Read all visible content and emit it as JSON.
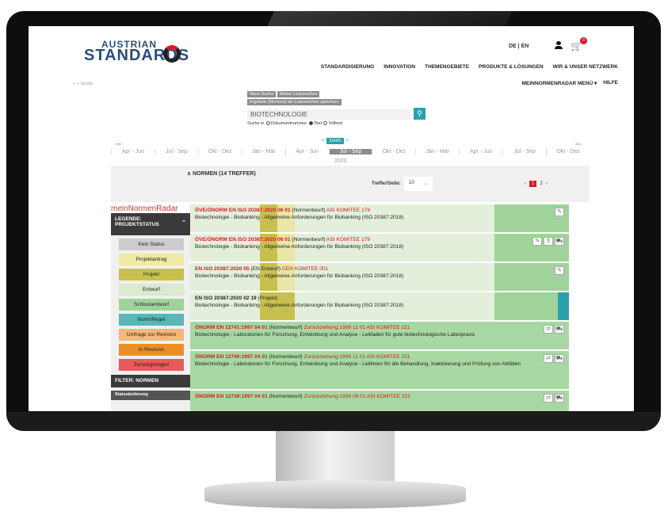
{
  "header": {
    "logo_small": "AUSTRIAN",
    "logo_big": "STANDARDS",
    "lang": "DE | EN",
    "cart_count": "0",
    "nav": [
      "STANDARDISIERUNG",
      "INNOVATION",
      "THEMENGEBIETE",
      "PRODUKTE & LÖSUNGEN",
      "WIR & UNSER NETZWERK"
    ],
    "breadcrumb": "⌂ > Suche",
    "subnav": [
      "MEINNORMENRADAR MENÜ ▾",
      "HILFE"
    ]
  },
  "search": {
    "btn_new": "Neue Suche",
    "btn_mark": "Meine Lesezeichen",
    "btn_save": "Ergebnis (Normen) als Lesezeichen speichern",
    "query": "BIOTECHNOLOGIE",
    "search_in_label": "Suche in",
    "opt_docnr": "Dokumentnummer",
    "opt_title": "Titel",
    "opt_fulltext": "Volltext"
  },
  "timeline": {
    "prev": "<<",
    "next": ">>",
    "zoom_label": "zoom",
    "periods": [
      "Apr - Jun",
      "Jul - Sep",
      "Okt - Dez",
      "Jän - Mär",
      "Apr - Jun",
      "Jul - Sep",
      "Okt - Dez",
      "Jän - Mär",
      "Apr - Jun",
      "Jul - Sep",
      "Okt - Dez"
    ],
    "selected_index": 5,
    "year": "2020"
  },
  "results": {
    "title": "∧  NORMEN (14 TREFFER)",
    "per_page_label": "Treffer/Seite:",
    "per_page": "10",
    "pages": [
      "‹",
      "1",
      "2",
      "›"
    ]
  },
  "sidebar": {
    "radar_title": "meinNormenRadar",
    "legend_title": "LEGENDE: PROJEKTSTATUS",
    "legend": [
      {
        "label": "Kein Status",
        "color": "#cccccc"
      },
      {
        "label": "Projektantrag",
        "color": "#efeaa4"
      },
      {
        "label": "Projekt",
        "color": "#c7c04f"
      },
      {
        "label": "Entwurf",
        "color": "#dbe9cf"
      },
      {
        "label": "Schlussentwurf",
        "color": "#9fd39a"
      },
      {
        "label": "Norm/Regel",
        "color": "#5bb6b8"
      },
      {
        "label": "Umfrage zur Revision",
        "color": "#f0b977"
      },
      {
        "label": "In Revision",
        "color": "#ec8e26"
      },
      {
        "label": "Zurückgezogen",
        "color": "#e85a57"
      }
    ],
    "filter_title": "FILTER: NORMEN",
    "status_change": "Statusänderung"
  },
  "rows": [
    {
      "id": "ÖVE/ÖNORM EN ISO 20387:2020 06 01",
      "type": " (Normentwurf) ",
      "extra": "ASI KOMITEE 179",
      "desc": "Biotechnologie - Biobanking - Allgemeine Anforderungen für Biobanking (ISO 20387:2018)",
      "bg": "#e3efdb",
      "id_red": true
    },
    {
      "id": "ÖVE/ÖNORM EN ISO 20387:2020 06 01",
      "type": " (Normentwurf) ",
      "extra": "ASI KOMITEE 179",
      "desc": "Biotechnologie - Biobanking - Allgemeine Anforderungen für Biobanking (ISO 20387:2018)",
      "bg": "#e3efdb",
      "id_red": true
    },
    {
      "id": "EN ISO 20387:2020 05",
      "type": " (EN Entwurf) ",
      "extra": "CEN KOMITEE 001",
      "desc": "Biotechnologie - Biobanking - Allgemeine Anforderungen für Biobanking (ISO 20387:2018)",
      "bg": "#e3efdb",
      "id_red": true
    },
    {
      "id": "EN ISO 20387:2020 02 19",
      "type": " (Projekt)",
      "extra": "",
      "desc": "Biotechnologie - Biobanking - Allgemeine Anforderungen für Biobanking (ISO 20387:2018)",
      "bg": "#e3efdb",
      "id_red": false
    },
    {
      "id": "ÖNORM EN 12741:1997 04 01",
      "type": " (Normentwurf) ",
      "extra": "Zurückziehung:1999 11 01 ASI KOMITEE 221",
      "desc": "Biotechnologie - Laboratorien für Forschung, Entwicklung und Analyse - Leitfaden für gute biotechnologische Laborpraxis",
      "bg": "#a8d8a2",
      "id_red": true
    },
    {
      "id": "ÖNORM EN 12740:1997 04 01",
      "type": " (Normentwurf) ",
      "extra": "Zurückziehung:1999 11 01 ASI KOMITEE 221",
      "desc": "Biotechnologie - Laboratorien für Forschung, Entwicklung und Analyse - Leitlinien für die Behandlung, Inaktivierung und Prüfung von Abfällen",
      "bg": "#a8d8a2",
      "id_red": true
    },
    {
      "id": "ÖNORM EN 12739:1997 04 01",
      "type": " (Normentwurf) ",
      "extra": "Zurückziehung:1999 09 01 ASI KOMITEE 221",
      "desc": "",
      "bg": "#a8d8a2",
      "id_red": true
    }
  ]
}
